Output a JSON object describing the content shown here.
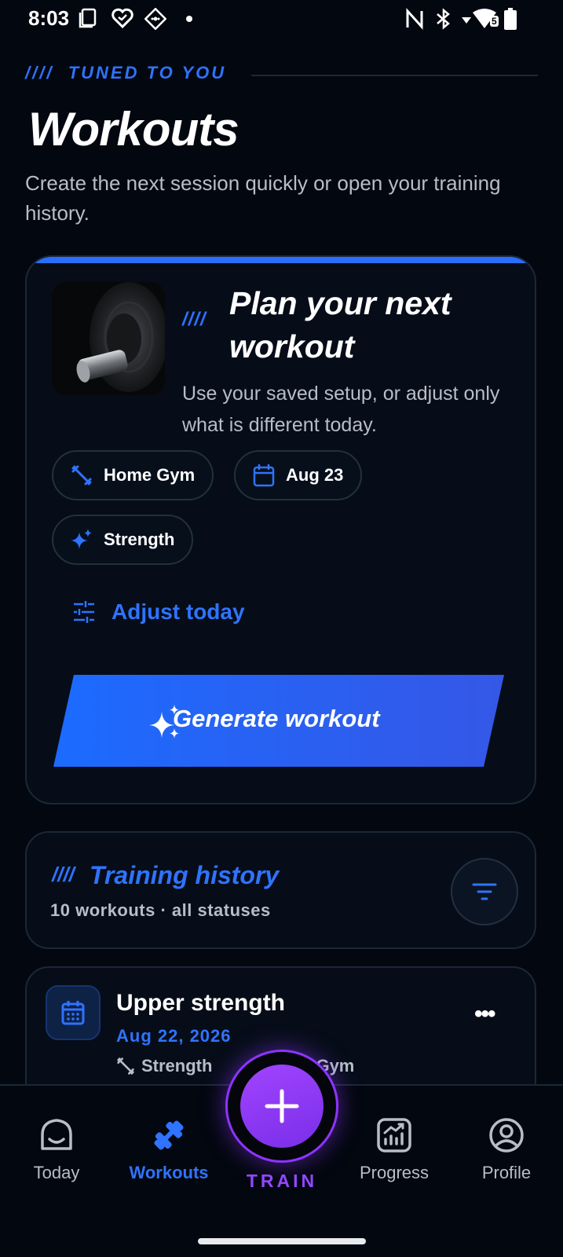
{
  "status_bar": {
    "time": "8:03",
    "icons": [
      "screenshot-icon",
      "app-icon",
      "app-icon",
      "dot-icon",
      "nfc-icon",
      "bluetooth-icon",
      "wifi-icon",
      "battery-icon"
    ],
    "wifi_badge": "5"
  },
  "header": {
    "eyebrow_slashes": "////",
    "eyebrow": "TUNED TO YOU",
    "title": "Workouts",
    "subtitle": "Create the next session quickly or open your training history."
  },
  "plan_card": {
    "slashes": "////",
    "title": "Plan your next workout",
    "description": "Use your saved setup, or adjust only what is different today.",
    "chips": [
      {
        "icon": "dumbbell-icon",
        "label": "Home Gym"
      },
      {
        "icon": "calendar-icon",
        "label": "Aug 23"
      },
      {
        "icon": "sparkle-icon",
        "label": "Strength"
      }
    ],
    "adjust_label": "Adjust today",
    "generate_label": "Generate workout"
  },
  "history": {
    "slashes": "////",
    "title": "Training history",
    "subtitle": "10 workouts · all statuses"
  },
  "workouts": [
    {
      "title": "Upper strength",
      "date": "Aug 22, 2026",
      "type": "Strength",
      "location_partial": "Gym"
    }
  ],
  "bottom_nav": {
    "items": [
      {
        "label": "Today",
        "icon": "home-icon"
      },
      {
        "label": "Workouts",
        "icon": "dumbbell-icon"
      },
      {
        "label": "Progress",
        "icon": "chart-icon"
      },
      {
        "label": "Profile",
        "icon": "profile-icon"
      }
    ],
    "active": "Workouts",
    "fab_label": "TRAIN"
  },
  "colors": {
    "background": "#03070f",
    "accent": "#2f73ff",
    "fab": "#8d34ff",
    "card_border": "#1b2838"
  }
}
